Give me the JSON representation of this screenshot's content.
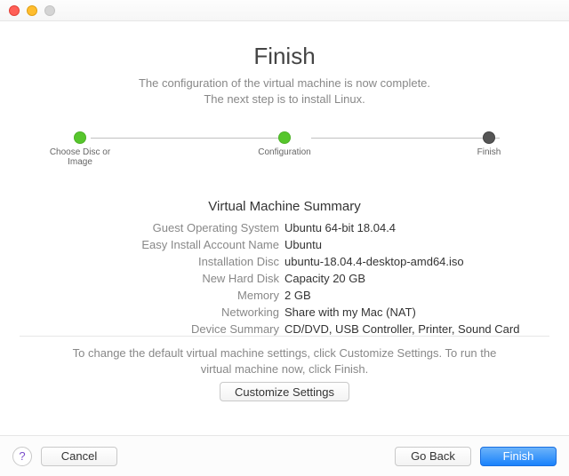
{
  "header": {
    "title": "Finish",
    "subtitle_line1": "The configuration of the virtual machine is now complete.",
    "subtitle_line2": "The next step is to install Linux."
  },
  "stepper": {
    "step1": "Choose Disc or Image",
    "step2": "Configuration",
    "step3": "Finish"
  },
  "summary": {
    "title": "Virtual Machine Summary",
    "labels": {
      "guest_os": "Guest Operating System",
      "easy_install": "Easy Install Account Name",
      "install_disc": "Installation Disc",
      "hard_disk": "New Hard Disk",
      "memory": "Memory",
      "networking": "Networking",
      "device_summary": "Device Summary"
    },
    "values": {
      "guest_os": "Ubuntu 64-bit 18.04.4",
      "easy_install": "Ubuntu",
      "install_disc": "ubuntu-18.04.4-desktop-amd64.iso",
      "hard_disk": "Capacity 20 GB",
      "memory": "2 GB",
      "networking": "Share with my Mac (NAT)",
      "device_summary": "CD/DVD, USB Controller, Printer, Sound Card"
    }
  },
  "footer_note_line1": "To change the default virtual machine settings, click Customize Settings. To run the",
  "footer_note_line2": "virtual machine now, click Finish.",
  "buttons": {
    "customize": "Customize Settings",
    "cancel": "Cancel",
    "go_back": "Go Back",
    "finish": "Finish"
  }
}
